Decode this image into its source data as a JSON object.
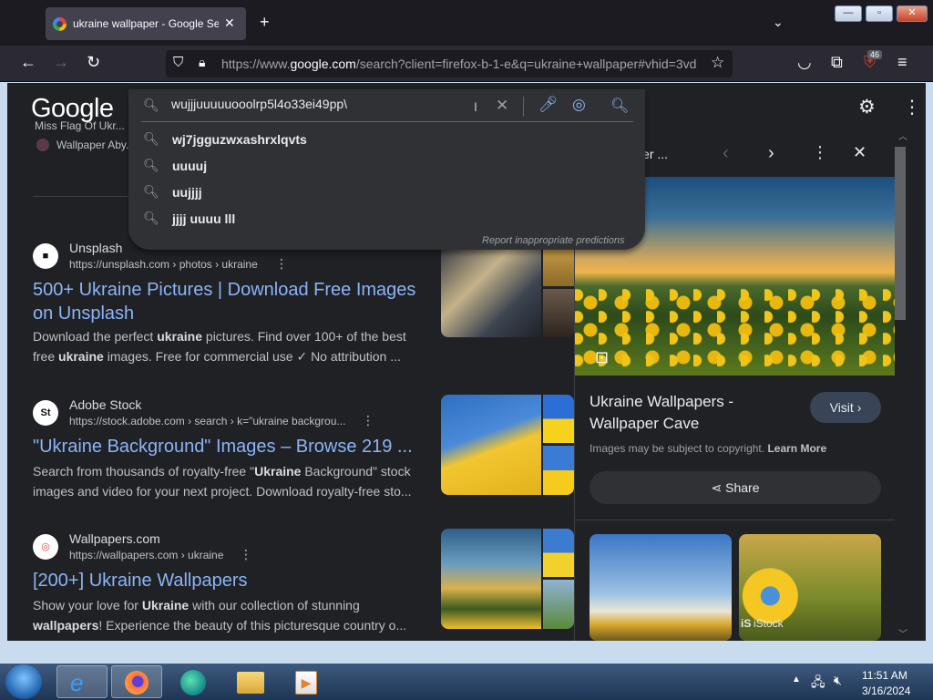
{
  "browser": {
    "tab_title": "ukraine wallpaper - Google Search",
    "url_prefix": "https://www.",
    "url_domain": "google.com",
    "url_rest": "/search?client=firefox-b-1-e&q=ukraine+wallpaper#vhid=3vd",
    "extension_badge": "46"
  },
  "google": {
    "logo": "Google",
    "search_value": "wujjjuuuuuooolrp5l4o33ei49pp\\",
    "suggestions": [
      "wj7jgguzwxashrxlqvts",
      "uuuuj",
      "uujjjj",
      "jjjj uuuu lll"
    ],
    "report_link": "Report inappropriate predictions"
  },
  "partial_top": {
    "line1": "Miss Flag Of Ukr...",
    "line2": "Wallpaper Aby..."
  },
  "results": [
    {
      "logo_text": "■",
      "site": "Unsplash",
      "url": "https://unsplash.com › photos › ukraine",
      "title": "500+ Ukraine Pictures | Download Free Images on Unsplash",
      "snippet_html_a": "Download the perfect ",
      "snippet_b1": "ukraine",
      "snippet_html_c": " pictures. Find over 100+ of the best free ",
      "snippet_b2": "ukraine",
      "snippet_html_d": " images. Free for commercial use ✓ No attribution ..."
    },
    {
      "logo_text": "St",
      "site": "Adobe Stock",
      "url": "https://stock.adobe.com › search › k=\"ukraine backgrou...",
      "title": "\"Ukraine Background\" Images – Browse 219 ...",
      "snippet_html_a": "Search from thousands of royalty-free \"",
      "snippet_b1": "Ukraine",
      "snippet_html_c": " Background\" stock images and video for your next project. Download royalty-free sto...",
      "snippet_b2": "",
      "snippet_html_d": ""
    },
    {
      "logo_text": "◎",
      "site": "Wallpapers.com",
      "url": "https://wallpapers.com › ukraine",
      "title": "[200+] Ukraine Wallpapers",
      "snippet_html_a": "Show your love for ",
      "snippet_b1": "Ukraine",
      "snippet_html_c": " with our collection of stunning ",
      "snippet_b2": "wallpapers",
      "snippet_html_d": "! Experience the beauty of this picturesque country o..."
    }
  ],
  "side_panel": {
    "header": "Wallpaper ...",
    "title": "Ukraine Wallpapers - Wallpaper Cave",
    "visit": "Visit",
    "copyright": "Images may be subject to copyright.",
    "learn_more": "Learn More",
    "share": "Share",
    "thumb2_source": "iStock"
  },
  "taskbar": {
    "time": "11:51 AM",
    "date": "3/16/2024"
  }
}
